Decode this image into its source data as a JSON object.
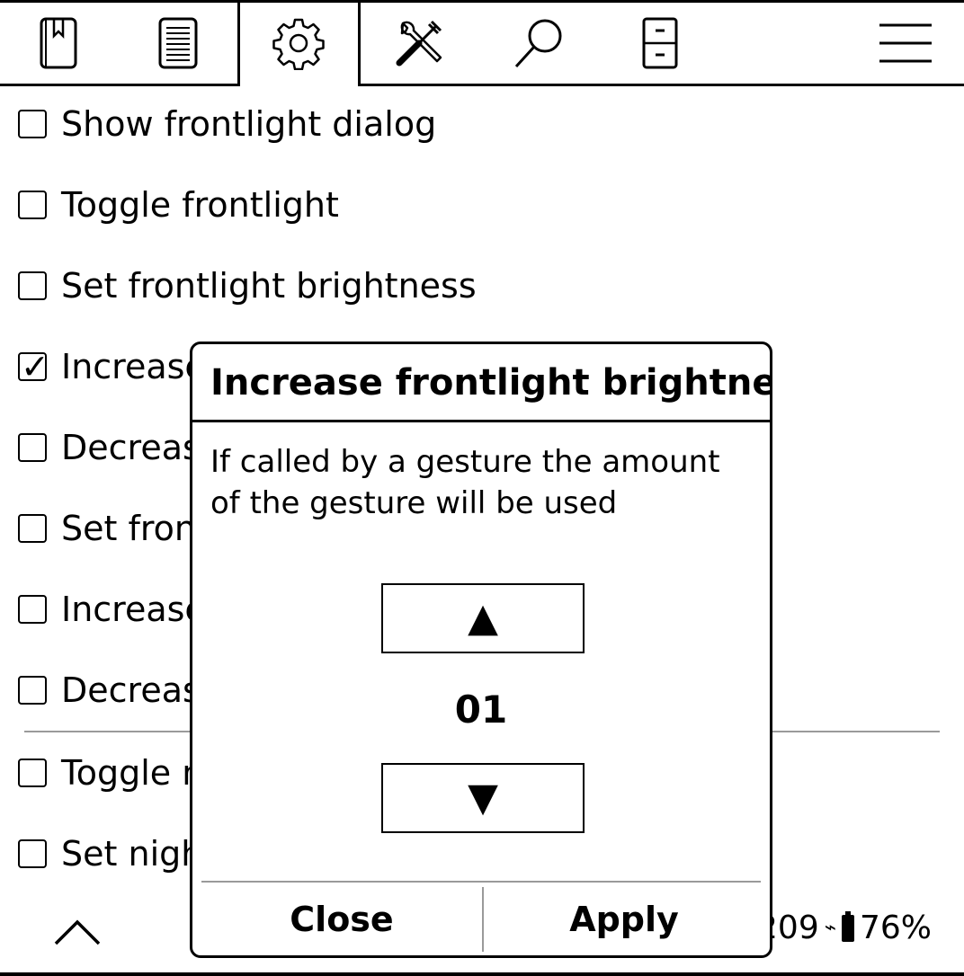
{
  "tabs": [
    {
      "name": "bookmark-icon"
    },
    {
      "name": "document-icon"
    },
    {
      "name": "gear-icon",
      "active": true
    },
    {
      "name": "tools-icon"
    },
    {
      "name": "search-icon"
    },
    {
      "name": "cabinet-icon"
    },
    {
      "name": "hamburger-menu-icon"
    }
  ],
  "list": {
    "items": [
      {
        "label": "Show frontlight dialog",
        "checked": false
      },
      {
        "label": "Toggle frontlight",
        "checked": false
      },
      {
        "label": "Set frontlight brightness",
        "checked": false
      },
      {
        "label": "Increase",
        "checked": true
      },
      {
        "label": "Decreas",
        "checked": false
      },
      {
        "label": "Set fron",
        "checked": false
      },
      {
        "label": "Increase",
        "checked": false
      },
      {
        "label": "Decreas",
        "checked": false
      },
      {
        "label": "Toggle n",
        "checked": false
      },
      {
        "label": "Set nigh",
        "checked": false
      }
    ]
  },
  "status": {
    "time": "209",
    "charging_symbol": "⌁",
    "battery": "76%"
  },
  "dialog": {
    "title": "Increase frontlight brightness",
    "description": "If called by a gesture the amount of the gesture will be used",
    "up_symbol": "▲",
    "down_symbol": "▼",
    "value": "01",
    "close_label": "Close",
    "apply_label": "Apply"
  }
}
